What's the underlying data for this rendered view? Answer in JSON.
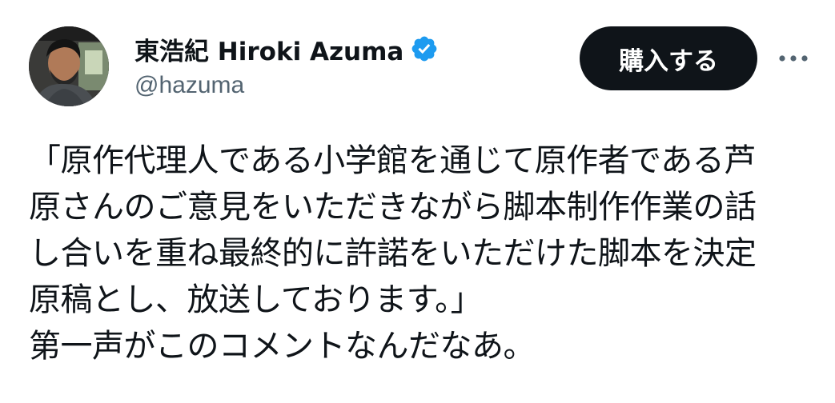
{
  "author": {
    "display_name": "東浩紀 Hiroki Azuma",
    "handle": "@hazuma",
    "verified": true,
    "verified_color": "#1d9bf0"
  },
  "actions": {
    "buy_label": "購入する",
    "more_icon": "more-horizontal-icon"
  },
  "tweet": {
    "lines": [
      "「原作代理人である小学館を通じて原作者である芦",
      "原さんのご意見をいただきながら脚本制作作業の話",
      "し合いを重ね最終的に許諾をいただけた脚本を決定",
      "原稿とし、放送しております。」",
      "第一声がこのコメントなんだなあ。"
    ]
  }
}
